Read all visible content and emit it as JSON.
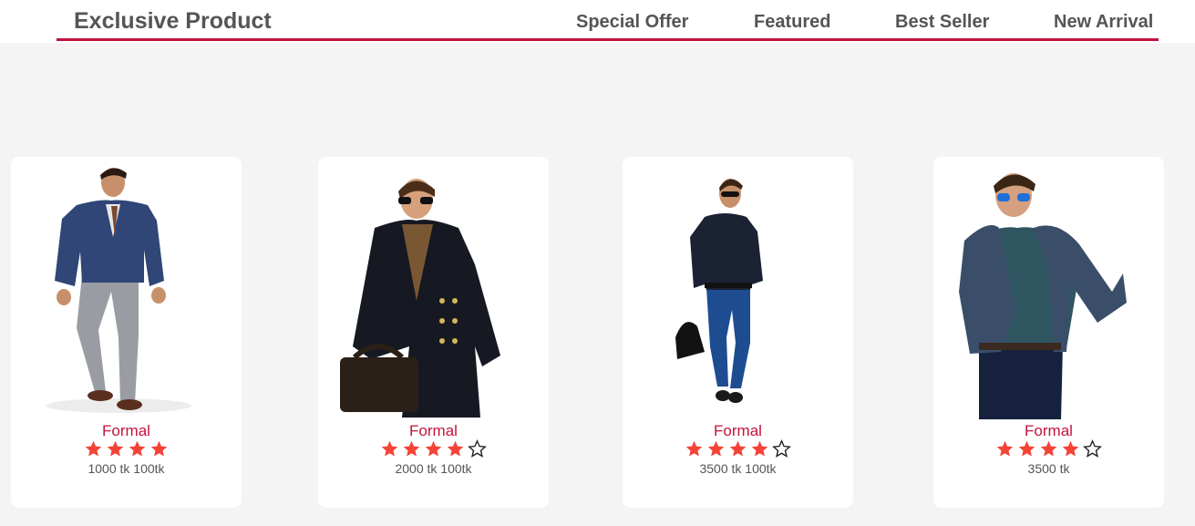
{
  "header": {
    "title": "Exclusive Product",
    "tabs": [
      {
        "label": "Special Offer"
      },
      {
        "label": "Featured"
      },
      {
        "label": "Best Seller"
      },
      {
        "label": "New Arrival"
      }
    ]
  },
  "colors": {
    "accent": "#c4123d",
    "star": "#f44336",
    "text": "#555555",
    "background": "#f4f4f4"
  },
  "products": [
    {
      "category": "Formal",
      "rating": 4,
      "rating_max": 4,
      "price": "1000 tk 100tk",
      "image": "man-in-navy-suit"
    },
    {
      "category": "Formal",
      "rating": 4,
      "rating_max": 5,
      "price": "2000 tk 100tk",
      "image": "man-in-black-coat-with-bag"
    },
    {
      "category": "Formal",
      "rating": 4,
      "rating_max": 5,
      "price": "3500 tk 100tk",
      "image": "man-in-navy-shirt-with-bag"
    },
    {
      "category": "Formal",
      "rating": 4,
      "rating_max": 5,
      "price": "3500 tk",
      "image": "man-in-blue-cardigan"
    }
  ]
}
